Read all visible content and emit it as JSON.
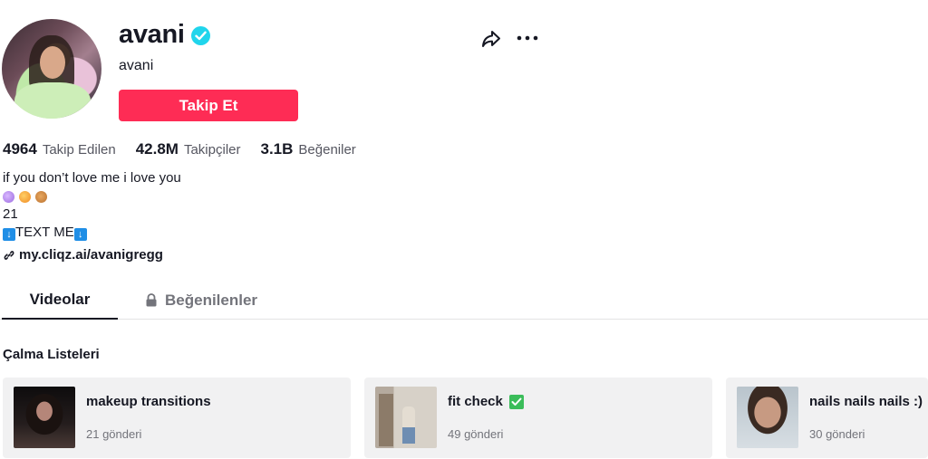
{
  "profile": {
    "username": "avani",
    "nickname": "avani",
    "follow_label": "Takip Et",
    "stats": [
      {
        "value": "4964",
        "label": "Takip Edilen"
      },
      {
        "value": "42.8M",
        "label": "Takipçiler"
      },
      {
        "value": "3.1B",
        "label": "Beğeniler"
      }
    ],
    "bio": {
      "line1": "if you don’t love me i love you",
      "line3": "21",
      "line4": "TEXT ME"
    },
    "link": "my.cliqz.ai/avanigregg"
  },
  "tabs": [
    {
      "label": "Videolar",
      "active": true
    },
    {
      "label": "Beğenilenler",
      "active": false,
      "locked": true
    }
  ],
  "playlists": {
    "title": "Çalma Listeleri",
    "items": [
      {
        "title": "makeup transitions",
        "count": "21 gönderi"
      },
      {
        "title": "fit check",
        "count": "49 gönderi"
      },
      {
        "title": "nails nails nails :)",
        "count": "30 gönderi"
      }
    ]
  },
  "colors": {
    "accent": "#fe2c55",
    "verified": "#20d5ec",
    "text": "#161823",
    "muted": "#73747b"
  },
  "icons": [
    "verified-badge-icon",
    "share-icon",
    "more-icon",
    "link-icon",
    "lock-icon",
    "check-icon"
  ]
}
